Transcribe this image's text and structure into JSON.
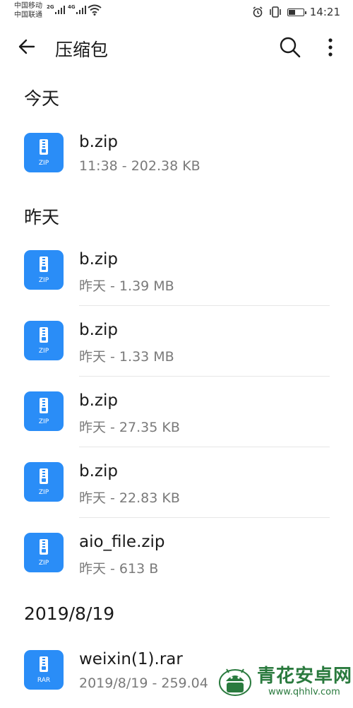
{
  "status_bar": {
    "carrier_1": "中国移动",
    "carrier_2": "中国联通",
    "net_1": "2G",
    "net_2": "4G",
    "time": "14:21",
    "battery_level": 0.45,
    "icons": [
      "alarm-icon",
      "vibrate-icon",
      "battery-icon",
      "wifi-icon",
      "signal-icon"
    ]
  },
  "app_bar": {
    "title": "压缩包",
    "back_icon": "arrow-left-icon",
    "search_icon": "search-icon",
    "more_icon": "more-vertical-icon"
  },
  "sections": [
    {
      "header": "今天",
      "items": [
        {
          "name": "b.zip",
          "meta": "11:38 - 202.38 KB",
          "type": "ZIP"
        }
      ]
    },
    {
      "header": "昨天",
      "items": [
        {
          "name": "b.zip",
          "meta": "昨天 - 1.39 MB",
          "type": "ZIP"
        },
        {
          "name": "b.zip",
          "meta": "昨天 - 1.33 MB",
          "type": "ZIP"
        },
        {
          "name": "b.zip",
          "meta": "昨天 - 27.35 KB",
          "type": "ZIP"
        },
        {
          "name": "b.zip",
          "meta": "昨天 - 22.83 KB",
          "type": "ZIP"
        },
        {
          "name": "aio_file.zip",
          "meta": "昨天 - 613 B",
          "type": "ZIP"
        }
      ]
    },
    {
      "header": "2019/8/19",
      "items": [
        {
          "name": "weixin(1).rar",
          "meta": "2019/8/19 - 259.04",
          "type": "RAR"
        }
      ]
    }
  ],
  "watermark": {
    "title": "青花安卓网",
    "url": "www.qhhlv.com"
  },
  "colors": {
    "icon_blue": "#2a8df7",
    "meta_gray": "#7a7a7a",
    "watermark_green": "#2a7a3e"
  }
}
